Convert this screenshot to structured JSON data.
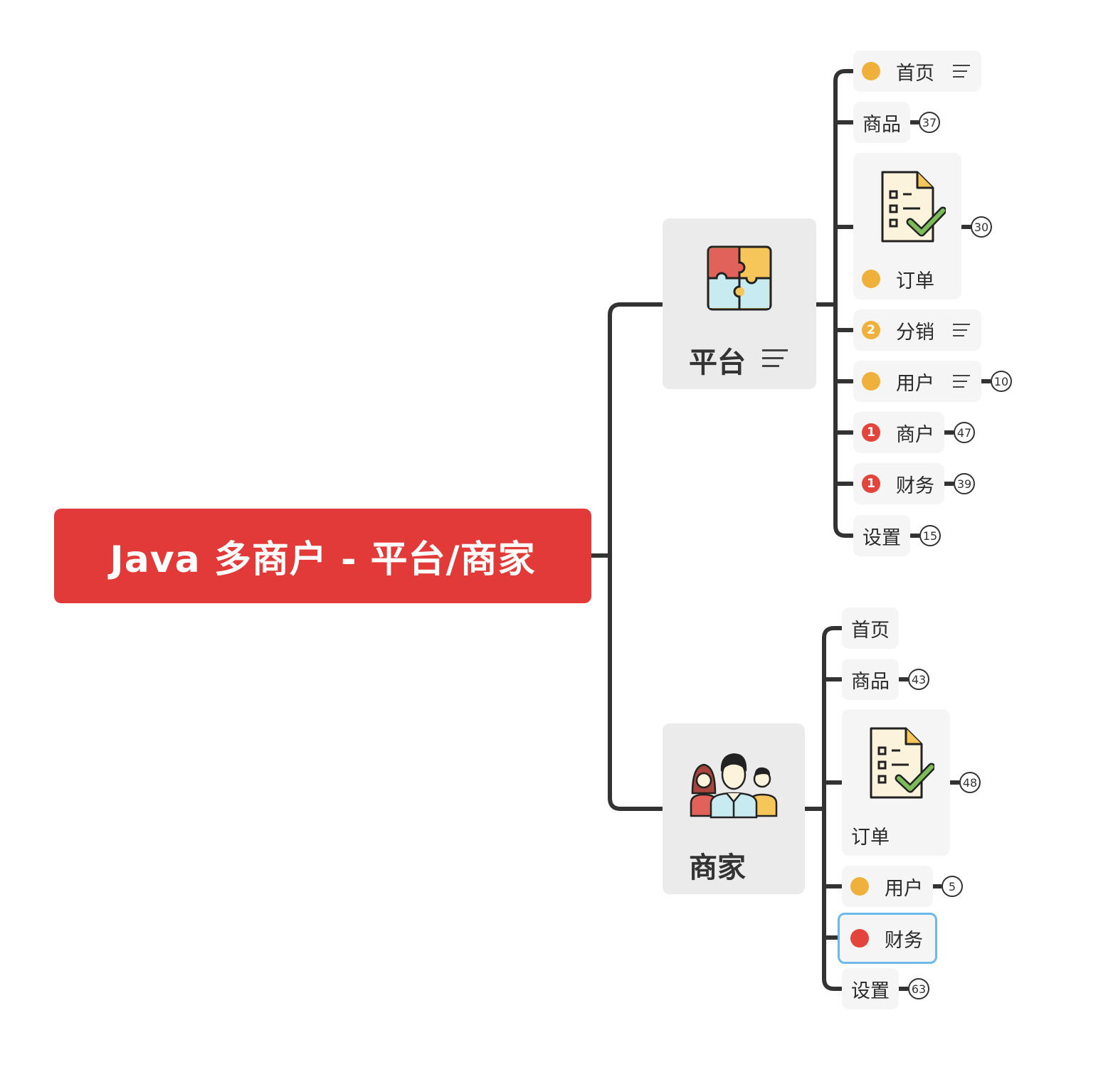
{
  "root": {
    "title": "Java 多商户 - 平台/商家"
  },
  "platform": {
    "label": "平台",
    "icon": "puzzle-icon",
    "children": [
      {
        "label": "首页",
        "marker": "yellow-dot",
        "note": true
      },
      {
        "label": "商品",
        "count": "37"
      },
      {
        "label": "订单",
        "marker": "yellow-dot",
        "icon": "checklist-icon",
        "count": "30"
      },
      {
        "label": "分销",
        "marker": "priority-2",
        "marker_text": "2",
        "note": true
      },
      {
        "label": "用户",
        "marker": "yellow-dot",
        "note": true,
        "count": "10"
      },
      {
        "label": "商户",
        "marker": "priority-1",
        "marker_text": "1",
        "count": "47"
      },
      {
        "label": "财务",
        "marker": "priority-1",
        "marker_text": "1",
        "count": "39"
      },
      {
        "label": "设置",
        "count": "15"
      }
    ]
  },
  "merchant": {
    "label": "商家",
    "icon": "team-icon",
    "children": [
      {
        "label": "首页"
      },
      {
        "label": "商品",
        "count": "43"
      },
      {
        "label": "订单",
        "icon": "checklist-icon",
        "count": "48"
      },
      {
        "label": "用户",
        "marker": "yellow-dot",
        "count": "5"
      },
      {
        "label": "财务",
        "marker": "red-dot",
        "selected": true
      },
      {
        "label": "设置",
        "count": "63"
      }
    ]
  },
  "colors": {
    "root": "#e13a38",
    "connector": "#333333",
    "yellow": "#f0b03c",
    "red": "#e3443c",
    "selection": "#6fb8ea"
  }
}
